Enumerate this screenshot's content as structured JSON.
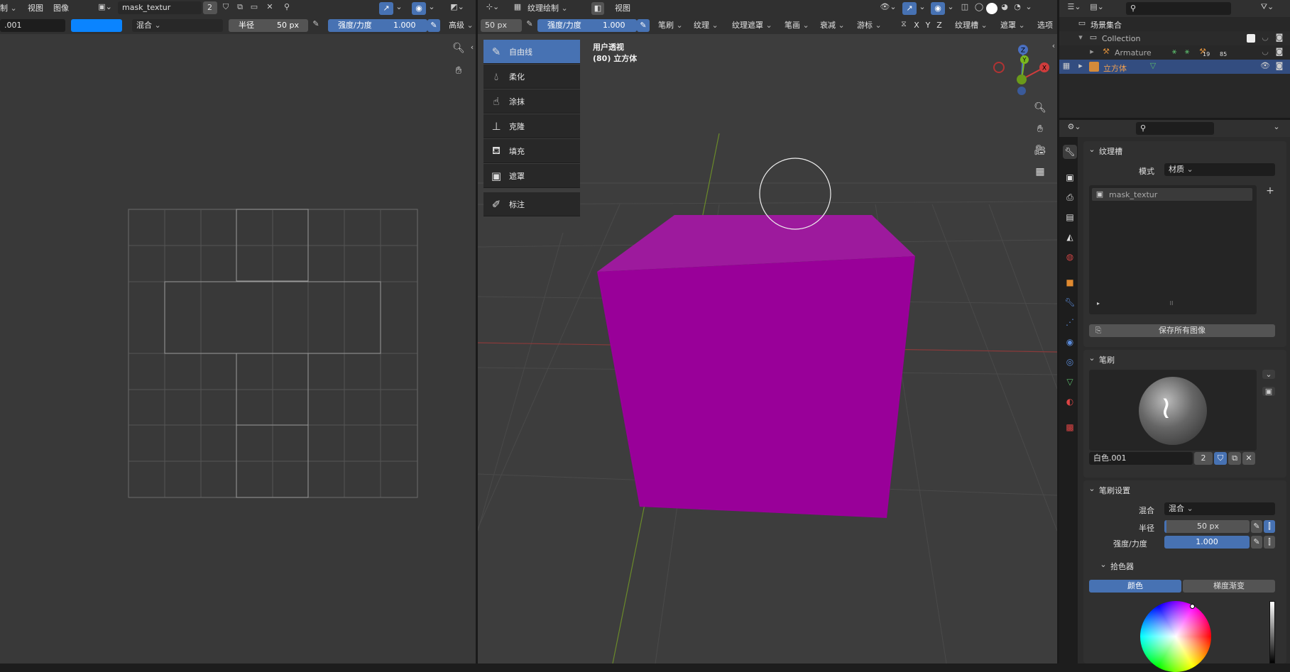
{
  "image_editor": {
    "menu": [
      "制",
      "视图",
      "图像"
    ],
    "image_name": "mask_textur",
    "users": "2",
    "brush_name": ".001",
    "blend": "混合",
    "radius_label": "半径",
    "radius_value": "50 px",
    "strength_label": "强度/力度",
    "strength_value": "1.000",
    "advanced": "高级"
  },
  "viewport": {
    "mode": "纹理绘制",
    "view_menu": "视图",
    "radius_value": "50 px",
    "strength_label": "强度/力度",
    "strength_value": "1.000",
    "menus": [
      "笔刷",
      "纹理",
      "纹理遮罩",
      "笔画",
      "衰减",
      "游标"
    ],
    "axes": [
      "X",
      "Y",
      "Z"
    ],
    "slots_menu": "纹理槽",
    "mask_menu": "遮罩",
    "options_menu": "选项",
    "view_title": "用户透视",
    "object_title": "(80) 立方体",
    "cube_color": "#990099",
    "gizmo": {
      "z": "Z",
      "y": "Y",
      "x": "X"
    },
    "tools": [
      {
        "label": "自由线",
        "icon": "brush-icon"
      },
      {
        "label": "柔化",
        "icon": "drop-icon"
      },
      {
        "label": "涂抹",
        "icon": "smear-icon"
      },
      {
        "label": "克隆",
        "icon": "stamp-icon"
      },
      {
        "label": "填充",
        "icon": "bucket-icon"
      },
      {
        "label": "遮罩",
        "icon": "mask-icon"
      },
      {
        "label": "标注",
        "icon": "annotate-icon"
      }
    ]
  },
  "outliner": {
    "scene_collection": "场景集合",
    "collection": "Collection",
    "armature": "Armature",
    "armature_count1": "19",
    "armature_count2": "85",
    "cube": "立方体"
  },
  "properties": {
    "texture_slots_panel": "纹理槽",
    "mode_label": "模式",
    "mode_value": "材质",
    "slot_item": "mask_textur",
    "save_all_images": "保存所有图像",
    "brush_panel": "笔刷",
    "brush_name": "白色.001",
    "brush_users": "2",
    "brush_settings_panel": "笔刷设置",
    "blend_label": "混合",
    "blend_value": "混合",
    "radius_label": "半径",
    "radius_value": "50 px",
    "strength_label": "强度/力度",
    "strength_value": "1.000",
    "color_picker_panel": "拾色器",
    "color_tab": "颜色",
    "gradient_tab": "梯度渐变"
  },
  "colors": {
    "accent": "#4772b3",
    "brush_color": "#0a84ff"
  }
}
